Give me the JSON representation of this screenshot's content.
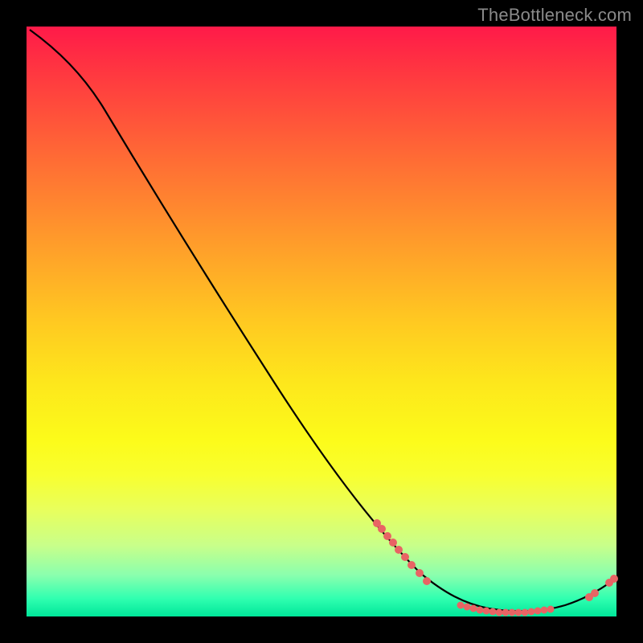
{
  "watermark": "TheBottleneck.com",
  "chart_data": {
    "type": "line",
    "title": "",
    "xlabel": "",
    "ylabel": "",
    "xlim": [
      0,
      100
    ],
    "ylim": [
      0,
      100
    ],
    "grid": false,
    "series": [
      {
        "name": "bottleneck-curve",
        "x": [
          0,
          5,
          10,
          15,
          20,
          25,
          30,
          35,
          40,
          45,
          50,
          55,
          60,
          65,
          70,
          75,
          78,
          80,
          82,
          85,
          88,
          90,
          92,
          95,
          98,
          100
        ],
        "y": [
          100,
          97,
          93,
          87,
          80,
          73,
          66,
          59,
          52,
          45,
          38,
          31,
          24,
          18,
          13,
          8,
          5,
          4,
          3,
          2,
          2,
          2,
          2,
          3,
          5,
          7
        ]
      }
    ],
    "markers": [
      {
        "name": "cluster-left",
        "x_range": [
          60,
          65
        ],
        "y_approx": 17
      },
      {
        "name": "cluster-mid",
        "x_range": [
          75,
          90
        ],
        "y_approx": 2
      },
      {
        "name": "cluster-right",
        "x_range": [
          95,
          100
        ],
        "y_approx": 6
      }
    ],
    "marker_color": "#e86464",
    "curve_color": "#000000"
  }
}
